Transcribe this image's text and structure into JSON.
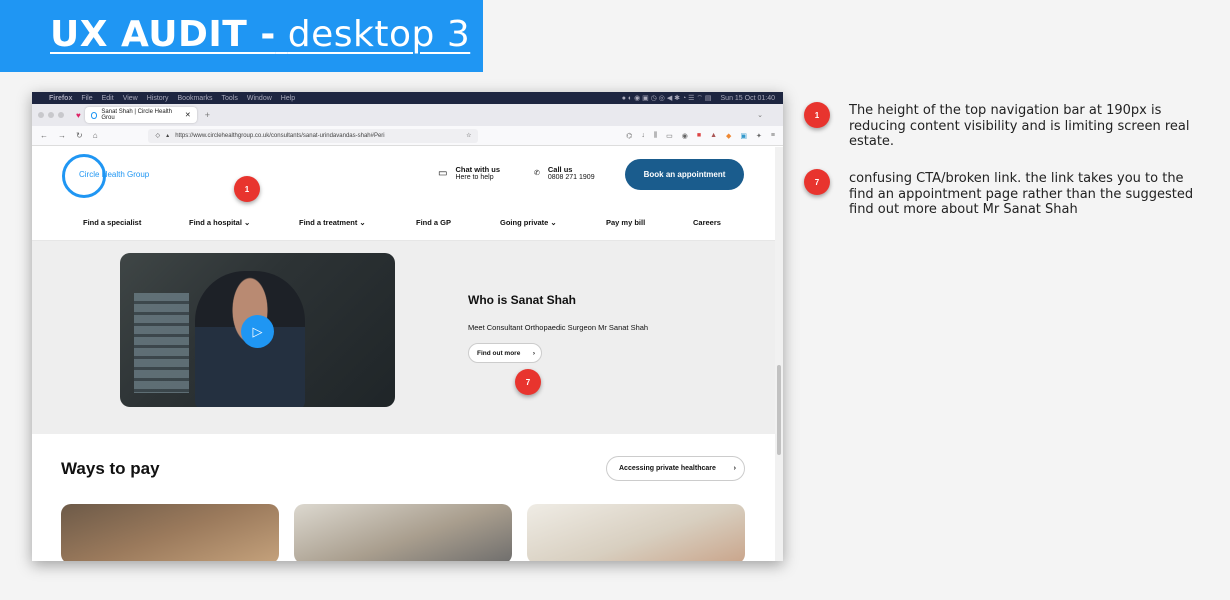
{
  "banner": {
    "title_bold": "UX AUDIT -",
    "title_light": "desktop 3"
  },
  "mac_menu": {
    "app": "Firefox",
    "items": [
      "File",
      "Edit",
      "View",
      "History",
      "Bookmarks",
      "Tools",
      "Window",
      "Help"
    ],
    "clock": "Sun 15 Oct 01:40"
  },
  "browser": {
    "tab_title": "Sanat Shah | Circle Health Grou",
    "tab_close": "✕",
    "new_tab": "+",
    "url": "https://www.circlehealthgroup.co.uk/consultants/sanat-urindavandas-shah#Peri"
  },
  "site": {
    "logo_text": "Circle Health Group",
    "chat_title": "Chat with us",
    "chat_sub": "Here to help",
    "call_title": "Call us",
    "call_number": "0808 271 1909",
    "book_button": "Book an appointment",
    "nav": [
      "Find a specialist",
      "Find a hospital ⌄",
      "Find a treatment ⌄",
      "Find a GP",
      "Going private ⌄",
      "Pay my bill",
      "Careers"
    ],
    "who_title": "Who is Sanat Shah",
    "meet_text": "Meet Consultant Orthopaedic Surgeon Mr Sanat Shah",
    "find_out_more": "Find out more",
    "ways_title": "Ways to pay",
    "accessing_button": "Accessing private healthcare"
  },
  "badges": {
    "b1": "1",
    "b7": "7"
  },
  "notes": {
    "n1": "The height of the top navigation bar at 190px is reducing content visibility and is limiting screen real estate.",
    "n7": "confusing CTA/broken link. the link takes you to the find an appointment page rather than the suggested find out more about Mr Sanat Shah"
  },
  "colors": {
    "banner": "#1f96f3",
    "badge": "#e8342e",
    "book_button": "#1a5c8d"
  }
}
